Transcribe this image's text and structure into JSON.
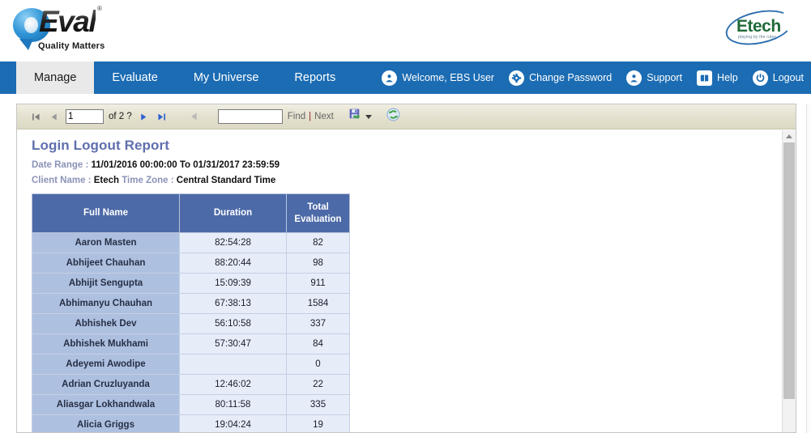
{
  "header": {
    "brand_logo": {
      "name": "QEval",
      "eval_text": "Eval",
      "registered": "®",
      "tagline": "Quality Matters"
    },
    "company_logo": {
      "name": "Etech",
      "tagline": "playing by the rules"
    }
  },
  "navbar": {
    "accent_color": "#1b6cb3",
    "active_tab_bg": "#e9e9e9",
    "tabs": [
      {
        "label": "Manage",
        "active": true
      },
      {
        "label": "Evaluate",
        "active": false
      },
      {
        "label": "My Universe",
        "active": false
      },
      {
        "label": "Reports",
        "active": false
      }
    ],
    "account_items": [
      {
        "label": "Welcome, EBS User",
        "icon": "user-icon"
      },
      {
        "label": "Change Password",
        "icon": "settings-gear-icon"
      },
      {
        "label": "Support",
        "icon": "user-headset-icon"
      },
      {
        "label": "Help",
        "icon": "book-icon"
      },
      {
        "label": "Logout",
        "icon": "power-icon"
      }
    ]
  },
  "toolbar": {
    "first_page_icon": "first-page-icon",
    "prev_page_icon": "previous-page-icon",
    "page_value": "1",
    "page_of": "of 2 ?",
    "next_page_icon": "next-page-icon",
    "last_page_icon": "last-page-icon",
    "back_icon": "back-arrow-icon",
    "find_value": "",
    "find_placeholder": "",
    "find_label": "Find",
    "find_separator": "|",
    "next_label": "Next",
    "export_icon": "export-save-icon",
    "export_dropdown_icon": "chevron-down-icon",
    "refresh_icon": "refresh-icon"
  },
  "report": {
    "title": "Login Logout Report",
    "title_color": "#5f6fae",
    "meta": {
      "date_range_label": "Date Range :",
      "date_range_value": "11/01/2016 00:00:00 To  01/31/2017 23:59:59",
      "client_name_label": "Client Name :",
      "client_name_value": "Etech",
      "time_zone_label": "Time Zone :",
      "time_zone_value": "Central Standard Time"
    },
    "table": {
      "header_bg": "#4d6aa8",
      "columns": [
        "Full Name",
        "Duration",
        "Total Evaluation"
      ],
      "column_lines": [
        [
          "Full Name"
        ],
        [
          "Duration"
        ],
        [
          "Total",
          "Evaluation"
        ]
      ],
      "rows": [
        {
          "full_name": "Aaron Masten",
          "duration": "82:54:28",
          "total_evaluation": "82"
        },
        {
          "full_name": "Abhijeet Chauhan",
          "duration": "88:20:44",
          "total_evaluation": "98"
        },
        {
          "full_name": "Abhijit Sengupta",
          "duration": "15:09:39",
          "total_evaluation": "911"
        },
        {
          "full_name": "Abhimanyu Chauhan",
          "duration": "67:38:13",
          "total_evaluation": "1584"
        },
        {
          "full_name": "Abhishek Dev",
          "duration": "56:10:58",
          "total_evaluation": "337"
        },
        {
          "full_name": "Abhishek Mukhami",
          "duration": "57:30:47",
          "total_evaluation": "84"
        },
        {
          "full_name": "Adeyemi Awodipe",
          "duration": "",
          "total_evaluation": "0"
        },
        {
          "full_name": "Adrian Cruzluyanda",
          "duration": "12:46:02",
          "total_evaluation": "22"
        },
        {
          "full_name": "Aliasgar Lokhandwala",
          "duration": "80:11:58",
          "total_evaluation": "335"
        },
        {
          "full_name": "Alicia Griggs",
          "duration": "19:04:24",
          "total_evaluation": "19"
        }
      ]
    }
  },
  "scrollbar": {
    "up_arrow_icon": "scroll-up-arrow-icon",
    "thumb": "scroll-thumb"
  }
}
